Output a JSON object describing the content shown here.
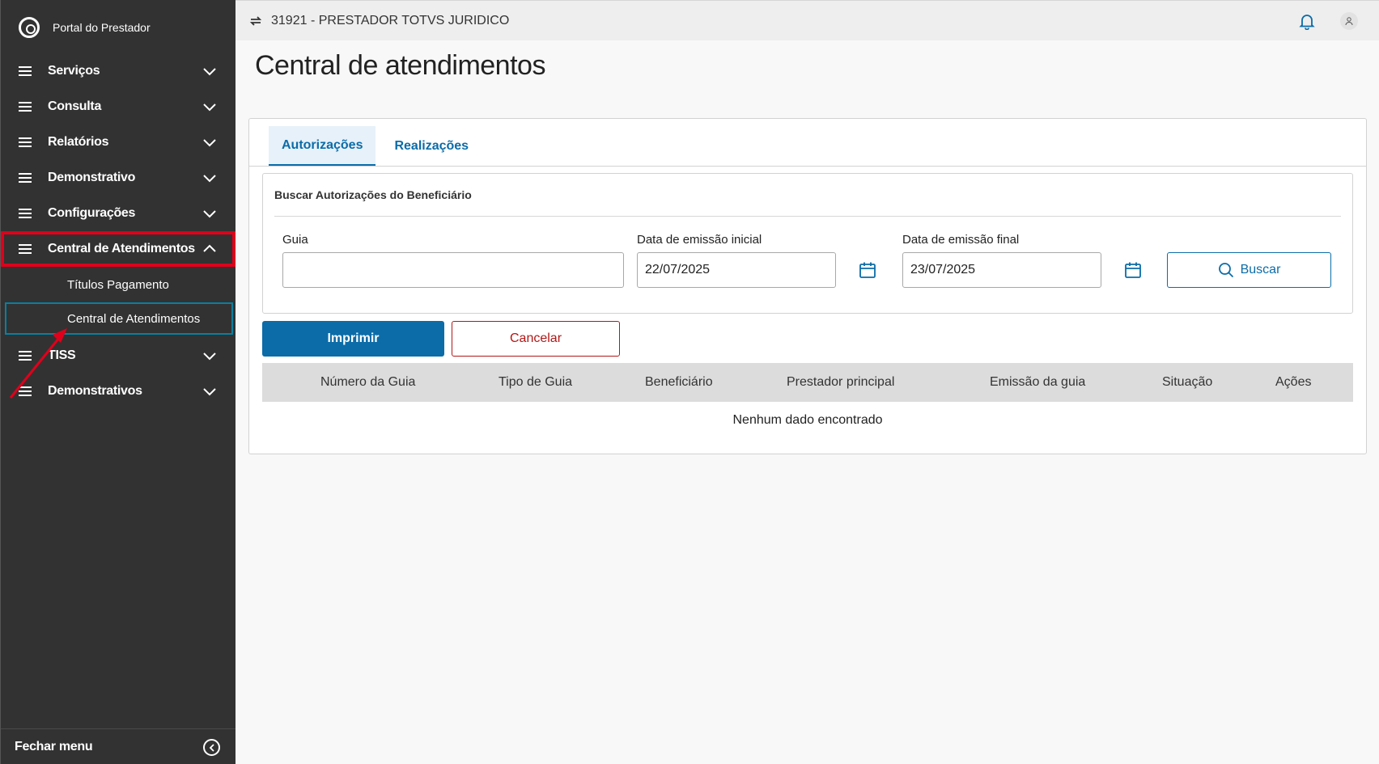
{
  "sidebar": {
    "brand": "Portal do Prestador",
    "items": [
      {
        "label": "Serviços"
      },
      {
        "label": "Consulta"
      },
      {
        "label": "Relatórios"
      },
      {
        "label": "Demonstrativo"
      },
      {
        "label": "Configurações"
      },
      {
        "label": "Central de Atendimentos"
      },
      {
        "label": "TISS"
      },
      {
        "label": "Demonstrativos"
      }
    ],
    "subitems": [
      {
        "label": "Títulos Pagamento"
      },
      {
        "label": "Central de Atendimentos"
      }
    ],
    "footer": {
      "label": "Fechar menu"
    }
  },
  "header": {
    "tenant": "31921 - PRESTADOR TOTVS JURIDICO"
  },
  "page": {
    "title": "Central de atendimentos"
  },
  "tabs": [
    {
      "label": "Autorizações"
    },
    {
      "label": "Realizações"
    }
  ],
  "search": {
    "title": "Buscar Autorizações do Beneficiário",
    "guia_label": "Guia",
    "guia_value": "",
    "data_inicial_label": "Data de emissão inicial",
    "data_inicial_value": "22/07/2025",
    "data_final_label": "Data de emissão final",
    "data_final_value": "23/07/2025",
    "buscar_label": "Buscar"
  },
  "actions": {
    "imprimir": "Imprimir",
    "cancelar": "Cancelar"
  },
  "table": {
    "columns": [
      "Número da Guia",
      "Tipo de Guia",
      "Beneficiário",
      "Prestador principal",
      "Emissão da guia",
      "Situação",
      "Ações"
    ],
    "empty": "Nenhum dado encontrado"
  },
  "colors": {
    "primary": "#0b6ca8",
    "sidebar": "#323232",
    "danger": "#b21717",
    "highlight": "#e0001b"
  }
}
